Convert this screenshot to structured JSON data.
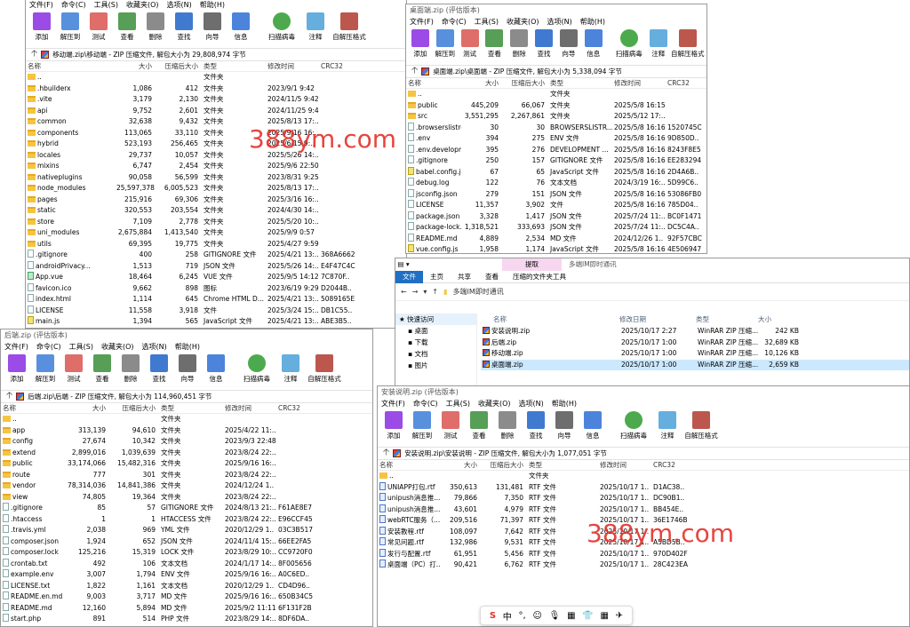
{
  "colors": {
    "watermark": "#e4312b",
    "explorer_file_tab": "#1f6fc4",
    "explorer_ctx_tab": "#f6d7ef",
    "selected_row": "#cce8ff"
  },
  "toolbar_items": [
    {
      "label": "添加",
      "icon": "add-icon"
    },
    {
      "label": "解压到",
      "icon": "extract-icon"
    },
    {
      "label": "测试",
      "icon": "test-icon"
    },
    {
      "label": "查看",
      "icon": "view-icon"
    },
    {
      "label": "删除",
      "icon": "delete-icon"
    },
    {
      "label": "查找",
      "icon": "find-icon"
    },
    {
      "label": "向导",
      "icon": "wizard-icon"
    },
    {
      "label": "信息",
      "icon": "info-icon"
    },
    {
      "label": "扫描病毒",
      "icon": "virus-scan-icon"
    },
    {
      "label": "注释",
      "icon": "comment-icon"
    },
    {
      "label": "自解压格式",
      "icon": "sfx-icon"
    }
  ],
  "menu_items": [
    "文件(F)",
    "命令(C)",
    "工具(S)",
    "收藏夹(O)",
    "选项(N)",
    "帮助(H)"
  ],
  "col_headers": {
    "name": "名称",
    "size": "大小",
    "packed": "压缩后大小",
    "type": "类型",
    "modified": "修改时间",
    "crc": "CRC32"
  },
  "win1": {
    "title": "",
    "address": "移动端.zip\\移动端 - ZIP 压缩文件, 解包大小为 29,808,974 字节",
    "rows": [
      {
        "n": "..",
        "s": "",
        "p": "",
        "t": "文件夹",
        "m": "",
        "c": "",
        "i": "up"
      },
      {
        "n": ".hbuilderx",
        "s": "1,086",
        "p": "412",
        "t": "文件夹",
        "m": "2023/9/1 9:42",
        "c": "",
        "i": "folder"
      },
      {
        "n": ".vite",
        "s": "3,179",
        "p": "2,130",
        "t": "文件夹",
        "m": "2024/11/5 9:42",
        "c": "",
        "i": "folder"
      },
      {
        "n": "api",
        "s": "9,752",
        "p": "2,601",
        "t": "文件夹",
        "m": "2024/11/25 9:42",
        "c": "",
        "i": "folder"
      },
      {
        "n": "common",
        "s": "32,638",
        "p": "9,432",
        "t": "文件夹",
        "m": "2025/8/13 17:..",
        "c": "",
        "i": "folder"
      },
      {
        "n": "components",
        "s": "113,065",
        "p": "33,110",
        "t": "文件夹",
        "m": "2025/9/16 16:..",
        "c": "",
        "i": "folder"
      },
      {
        "n": "hybrid",
        "s": "523,193",
        "p": "256,465",
        "t": "文件夹",
        "m": "2025/6/15 9:..",
        "c": "",
        "i": "folder"
      },
      {
        "n": "locales",
        "s": "29,737",
        "p": "10,057",
        "t": "文件夹",
        "m": "2025/5/26 14:..",
        "c": "",
        "i": "folder"
      },
      {
        "n": "mixins",
        "s": "6,747",
        "p": "2,454",
        "t": "文件夹",
        "m": "2025/9/6 22:50",
        "c": "",
        "i": "folder"
      },
      {
        "n": "nativeplugins",
        "s": "90,058",
        "p": "56,599",
        "t": "文件夹",
        "m": "2023/8/31 9:25",
        "c": "",
        "i": "folder"
      },
      {
        "n": "node_modules",
        "s": "25,597,378",
        "p": "6,005,523",
        "t": "文件夹",
        "m": "2025/8/13 17:..",
        "c": "",
        "i": "folder"
      },
      {
        "n": "pages",
        "s": "215,916",
        "p": "69,306",
        "t": "文件夹",
        "m": "2025/3/16 16:..",
        "c": "",
        "i": "folder"
      },
      {
        "n": "static",
        "s": "320,553",
        "p": "203,554",
        "t": "文件夹",
        "m": "2024/4/30 14:..",
        "c": "",
        "i": "folder"
      },
      {
        "n": "store",
        "s": "7,109",
        "p": "2,778",
        "t": "文件夹",
        "m": "2025/5/20 10:..",
        "c": "",
        "i": "folder"
      },
      {
        "n": "uni_modules",
        "s": "2,675,884",
        "p": "1,413,540",
        "t": "文件夹",
        "m": "2025/9/9 0:57",
        "c": "",
        "i": "folder"
      },
      {
        "n": "utils",
        "s": "69,395",
        "p": "19,775",
        "t": "文件夹",
        "m": "2025/4/27 9:59",
        "c": "",
        "i": "folder"
      },
      {
        "n": ".gitignore",
        "s": "400",
        "p": "258",
        "t": "GITIGNORE 文件",
        "m": "2025/4/21 13:..",
        "c": "368A6662",
        "i": "file"
      },
      {
        "n": "androidPrivacy...",
        "s": "1,513",
        "p": "719",
        "t": "JSON 文件",
        "m": "2025/5/26 14:..",
        "c": "E4F47C4C",
        "i": "file"
      },
      {
        "n": "App.vue",
        "s": "18,464",
        "p": "6,245",
        "t": "VUE 文件",
        "m": "2025/9/5 14:12",
        "c": "7C870F..",
        "i": "vue"
      },
      {
        "n": "favicon.ico",
        "s": "9,662",
        "p": "898",
        "t": "图标",
        "m": "2023/6/19 9:29",
        "c": "D2044B..",
        "i": "file"
      },
      {
        "n": "index.html",
        "s": "1,114",
        "p": "645",
        "t": "Chrome HTML D...",
        "m": "2025/4/21 13:..",
        "c": "5089165E",
        "i": "file"
      },
      {
        "n": "LICENSE",
        "s": "11,558",
        "p": "3,918",
        "t": "文件",
        "m": "2025/3/24 15:..",
        "c": "DB1C55..",
        "i": "file"
      },
      {
        "n": "main.js",
        "s": "1,394",
        "p": "565",
        "t": "JavaScript 文件",
        "m": "2025/4/21 13:..",
        "c": "ABE3B5..",
        "i": "js"
      }
    ]
  },
  "win2": {
    "title": "桌面端.zip (评估版本)",
    "address": "桌面端.zip\\桌面端 - ZIP 压缩文件, 解包大小为 5,338,094 字节",
    "rows": [
      {
        "n": "..",
        "s": "",
        "p": "",
        "t": "文件夹",
        "m": "",
        "c": "",
        "i": "up"
      },
      {
        "n": "public",
        "s": "445,209",
        "p": "66,067",
        "t": "文件夹",
        "m": "2025/5/8 16:15",
        "c": "",
        "i": "folder"
      },
      {
        "n": "src",
        "s": "3,551,295",
        "p": "2,267,861",
        "t": "文件夹",
        "m": "2025/5/12 17:..",
        "c": "",
        "i": "folder"
      },
      {
        "n": ".browserslistrc",
        "s": "30",
        "p": "30",
        "t": "BROWSERSLISTR...",
        "m": "2025/5/8 16:16",
        "c": "1520745C",
        "i": "file"
      },
      {
        "n": ".env",
        "s": "394",
        "p": "275",
        "t": "ENV 文件",
        "m": "2025/5/8 16:16",
        "c": "9D850D..",
        "i": "file"
      },
      {
        "n": ".env.developm...",
        "s": "395",
        "p": "276",
        "t": "DEVELOPMENT ...",
        "m": "2025/5/8 16:16",
        "c": "8243F8E5",
        "i": "file"
      },
      {
        "n": ".gitignore",
        "s": "250",
        "p": "157",
        "t": "GITIGNORE 文件",
        "m": "2025/5/8 16:16",
        "c": "EE283294",
        "i": "file"
      },
      {
        "n": "babel.config.js",
        "s": "67",
        "p": "65",
        "t": "JavaScript 文件",
        "m": "2025/5/8 16:16",
        "c": "2D4A6B..",
        "i": "js"
      },
      {
        "n": "debug.log",
        "s": "122",
        "p": "76",
        "t": "文本文档",
        "m": "2024/3/19 16:..",
        "c": "5D99C6..",
        "i": "file"
      },
      {
        "n": "jsconfig.json",
        "s": "279",
        "p": "151",
        "t": "JSON 文件",
        "m": "2025/5/8 16:16",
        "c": "53086FB0",
        "i": "file"
      },
      {
        "n": "LICENSE",
        "s": "11,357",
        "p": "3,902",
        "t": "文件",
        "m": "2025/5/8 16:16",
        "c": "785D04..",
        "i": "file"
      },
      {
        "n": "package.json",
        "s": "3,328",
        "p": "1,417",
        "t": "JSON 文件",
        "m": "2025/7/24 11:..",
        "c": "BC0F1471",
        "i": "file"
      },
      {
        "n": "package-lock.j...",
        "s": "1,318,521",
        "p": "333,693",
        "t": "JSON 文件",
        "m": "2025/7/24 11:..",
        "c": "DC5C4A..",
        "i": "file"
      },
      {
        "n": "README.md",
        "s": "4,889",
        "p": "2,534",
        "t": "MD 文件",
        "m": "2024/12/26 1..",
        "c": "92F57CBC",
        "i": "file"
      },
      {
        "n": "vue.config.js",
        "s": "1,958",
        "p": "1,174",
        "t": "JavaScript 文件",
        "m": "2025/5/8 16:16",
        "c": "4E506947",
        "i": "js"
      }
    ]
  },
  "win3": {
    "title": "后端.zip (评估版本)",
    "address": "后端.zip\\后端 - ZIP 压缩文件, 解包大小为 114,960,451 字节",
    "rows": [
      {
        "n": "..",
        "s": "",
        "p": "",
        "t": "文件夹",
        "m": "",
        "c": "",
        "i": "up"
      },
      {
        "n": "app",
        "s": "313,139",
        "p": "94,610",
        "t": "文件夹",
        "m": "2025/4/22 11:..",
        "c": "",
        "i": "folder"
      },
      {
        "n": "config",
        "s": "27,674",
        "p": "10,342",
        "t": "文件夹",
        "m": "2023/9/3 22:48",
        "c": "",
        "i": "folder"
      },
      {
        "n": "extend",
        "s": "2,899,016",
        "p": "1,039,639",
        "t": "文件夹",
        "m": "2023/8/24 22:..",
        "c": "",
        "i": "folder"
      },
      {
        "n": "public",
        "s": "33,174,066",
        "p": "15,482,316",
        "t": "文件夹",
        "m": "2025/9/16 16:..",
        "c": "",
        "i": "folder"
      },
      {
        "n": "route",
        "s": "777",
        "p": "301",
        "t": "文件夹",
        "m": "2023/8/24 22:..",
        "c": "",
        "i": "folder"
      },
      {
        "n": "vendor",
        "s": "78,314,036",
        "p": "14,841,386",
        "t": "文件夹",
        "m": "2024/12/24 1..",
        "c": "",
        "i": "folder"
      },
      {
        "n": "view",
        "s": "74,805",
        "p": "19,364",
        "t": "文件夹",
        "m": "2023/8/24 22:..",
        "c": "",
        "i": "folder"
      },
      {
        "n": ".gitignore",
        "s": "85",
        "p": "57",
        "t": "GITIGNORE 文件",
        "m": "2024/8/13 21:..",
        "c": "F61AE8E7",
        "i": "file"
      },
      {
        "n": ".htaccess",
        "s": "1",
        "p": "1",
        "t": "HTACCESS 文件",
        "m": "2023/8/24 22:..",
        "c": "E96CCF45",
        "i": "file"
      },
      {
        "n": ".travis.yml",
        "s": "2,038",
        "p": "969",
        "t": "YML 文件",
        "m": "2020/12/29 1..",
        "c": "03C3B517",
        "i": "file"
      },
      {
        "n": "composer.json",
        "s": "1,924",
        "p": "652",
        "t": "JSON 文件",
        "m": "2024/11/4 15:..",
        "c": "66EE2FA5",
        "i": "file"
      },
      {
        "n": "composer.lock",
        "s": "125,216",
        "p": "15,319",
        "t": "LOCK 文件",
        "m": "2023/8/29 10:..",
        "c": "CC9720F0",
        "i": "file"
      },
      {
        "n": "crontab.txt",
        "s": "492",
        "p": "106",
        "t": "文本文档",
        "m": "2024/1/17 14:..",
        "c": "8F005656",
        "i": "file"
      },
      {
        "n": "example.env",
        "s": "3,007",
        "p": "1,794",
        "t": "ENV 文件",
        "m": "2025/9/16 16:..",
        "c": "A0C6ED..",
        "i": "file"
      },
      {
        "n": "LICENSE.txt",
        "s": "1,822",
        "p": "1,161",
        "t": "文本文档",
        "m": "2020/12/29 1..",
        "c": "CD4D96..",
        "i": "file"
      },
      {
        "n": "README.en.md",
        "s": "9,003",
        "p": "3,717",
        "t": "MD 文件",
        "m": "2025/9/16 16:..",
        "c": "650B34C5",
        "i": "file"
      },
      {
        "n": "README.md",
        "s": "12,160",
        "p": "5,894",
        "t": "MD 文件",
        "m": "2025/9/2 11:11",
        "c": "6F131F2B",
        "i": "file"
      },
      {
        "n": "start.php",
        "s": "891",
        "p": "514",
        "t": "PHP 文件",
        "m": "2023/8/29 14:..",
        "c": "8DF6DA..",
        "i": "file"
      }
    ]
  },
  "win4": {
    "title": "安装说明.zip (评估版本)",
    "address": "安装说明.zip\\安装说明 - ZIP 压缩文件, 解包大小为 1,077,051 字节",
    "rows": [
      {
        "n": "..",
        "s": "",
        "p": "",
        "t": "文件夹",
        "m": "",
        "c": "",
        "i": "up"
      },
      {
        "n": "UNIAPP打包.rtf",
        "s": "350,613",
        "p": "131,481",
        "t": "RTF 文件",
        "m": "2025/10/17 1..",
        "c": "D1AC38..",
        "i": "rtf"
      },
      {
        "n": "unipush消息推...",
        "s": "79,866",
        "p": "7,350",
        "t": "RTF 文件",
        "m": "2025/10/17 1..",
        "c": "DC90B1..",
        "i": "rtf"
      },
      {
        "n": "unipush消息推...",
        "s": "43,601",
        "p": "4,979",
        "t": "RTF 文件",
        "m": "2025/10/17 1..",
        "c": "BB454E..",
        "i": "rtf"
      },
      {
        "n": "webRTC服务（...",
        "s": "209,516",
        "p": "71,397",
        "t": "RTF 文件",
        "m": "2025/10/17 1..",
        "c": "36E1746B",
        "i": "rtf"
      },
      {
        "n": "安装教程.rtf",
        "s": "108,097",
        "p": "7,642",
        "t": "RTF 文件",
        "m": "2025/10/17 1..",
        "c": "",
        "i": "rtf"
      },
      {
        "n": "常见问题.rtf",
        "s": "132,986",
        "p": "9,531",
        "t": "RTF 文件",
        "m": "2025/10/17 1..",
        "c": "A5BD5B..",
        "i": "rtf"
      },
      {
        "n": "发行与配置.rtf",
        "s": "61,951",
        "p": "5,456",
        "t": "RTF 文件",
        "m": "2025/10/17 1..",
        "c": "970D402F",
        "i": "rtf"
      },
      {
        "n": "桌面端（PC）打...",
        "s": "90,421",
        "p": "6,762",
        "t": "RTF 文件",
        "m": "2025/10/17 1..",
        "c": "28C423EA",
        "i": "rtf"
      }
    ]
  },
  "explorer": {
    "title_ctx": "提取",
    "title_path": "多端IM即时通讯",
    "tabs": [
      "文件",
      "主页",
      "共享",
      "查看",
      "压缩的文件夹工具"
    ],
    "crumb": "多端IM即时通讯",
    "side": [
      "快速访问",
      "桌面",
      "下载",
      "文档",
      "图片"
    ],
    "headers": {
      "name": "名称",
      "modified": "修改日期",
      "type": "类型",
      "size": "大小"
    },
    "rows": [
      {
        "n": "安装说明.zip",
        "m": "2025/10/17 2:27",
        "t": "WinRAR ZIP 压缩...",
        "s": "242 KB",
        "sel": false
      },
      {
        "n": "后端.zip",
        "m": "2025/10/17 1:00",
        "t": "WinRAR ZIP 压缩...",
        "s": "32,689 KB",
        "sel": false
      },
      {
        "n": "移动端.zip",
        "m": "2025/10/17 1:00",
        "t": "WinRAR ZIP 压缩...",
        "s": "10,126 KB",
        "sel": false
      },
      {
        "n": "桌面端.zip",
        "m": "2025/10/17 1:00",
        "t": "WinRAR ZIP 压缩...",
        "s": "2,659 KB",
        "sel": true
      }
    ]
  },
  "watermark": "388ym.com",
  "ime": [
    "S",
    "中",
    "°,",
    "☺",
    "🎙",
    "▦",
    "👕",
    "▦",
    "✈"
  ]
}
